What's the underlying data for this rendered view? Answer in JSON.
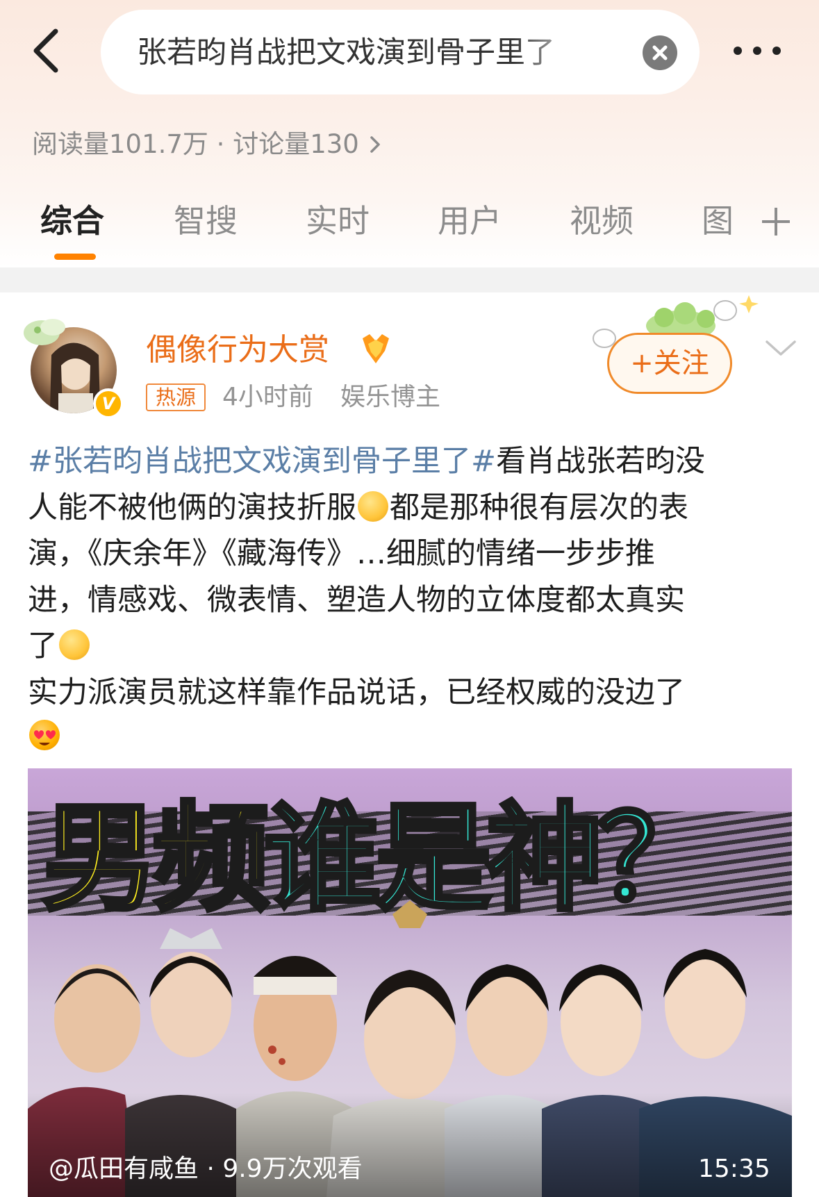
{
  "search": {
    "query": "张若昀肖战把文戏演到骨子里了"
  },
  "stats": {
    "text": "阅读量101.7万 · 讨论量130"
  },
  "tabs": [
    "综合",
    "智搜",
    "实时",
    "用户",
    "视频",
    "图"
  ],
  "post": {
    "author": "偶像行为大赏",
    "source_tag": "热源",
    "time": "4小时前",
    "author_type": "娱乐博主",
    "follow_label": "+关注",
    "hashtag": "#张若昀肖战把文戏演到骨子里了#",
    "line1_rest": "看肖战张若昀没",
    "line2_a": "人能不被他俩的演技折服",
    "line2_b": "都是那种很有层次的表",
    "line3": "演，《庆余年》《藏海传》…细腻的情绪一步步推",
    "line4": "进，情感戏、微表情、塑造人物的立体度都太真实",
    "line5": "了",
    "line6": "实力派演员就这样靠作品说话，已经权威的没边了"
  },
  "video": {
    "headline_yellow": "男频",
    "headline_cyan": "谁是神？",
    "info": "@瓜田有咸鱼 · 9.9万次观看",
    "duration": "15:35"
  },
  "colors": {
    "accent_orange": "#ff8200",
    "username": "#ea6d18",
    "hashtag": "#5a7ea6",
    "headline_yellow": "#ffef1f",
    "headline_cyan": "#34e6d3"
  },
  "icons": [
    "back-arrow-icon",
    "clear-icon",
    "more-icon",
    "chevron-right-icon",
    "add-tab-icon",
    "verified-v-icon",
    "medal-icon",
    "chevron-down-icon",
    "pray-emoji-icon",
    "heart-eyes-emoji-icon"
  ]
}
